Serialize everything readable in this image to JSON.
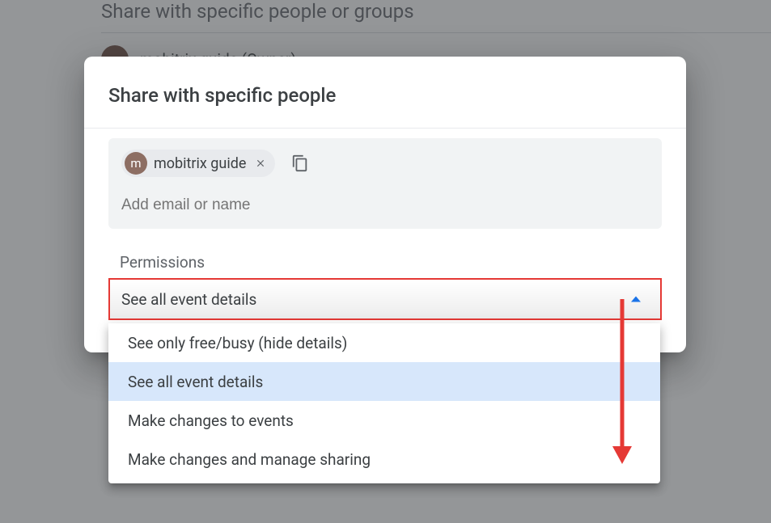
{
  "background": {
    "heading": "Share with specific people or groups",
    "owner_label": "mobitrix guide (Owner)"
  },
  "dialog": {
    "title": "Share with specific people",
    "chip": {
      "avatar_initial": "m",
      "label": "mobitrix guide"
    },
    "email_placeholder": "Add email or name",
    "permissions_label": "Permissions",
    "selected_permission": "See all event details",
    "options": [
      "See only free/busy (hide details)",
      "See all event details",
      "Make changes to events",
      "Make changes and manage sharing"
    ]
  }
}
